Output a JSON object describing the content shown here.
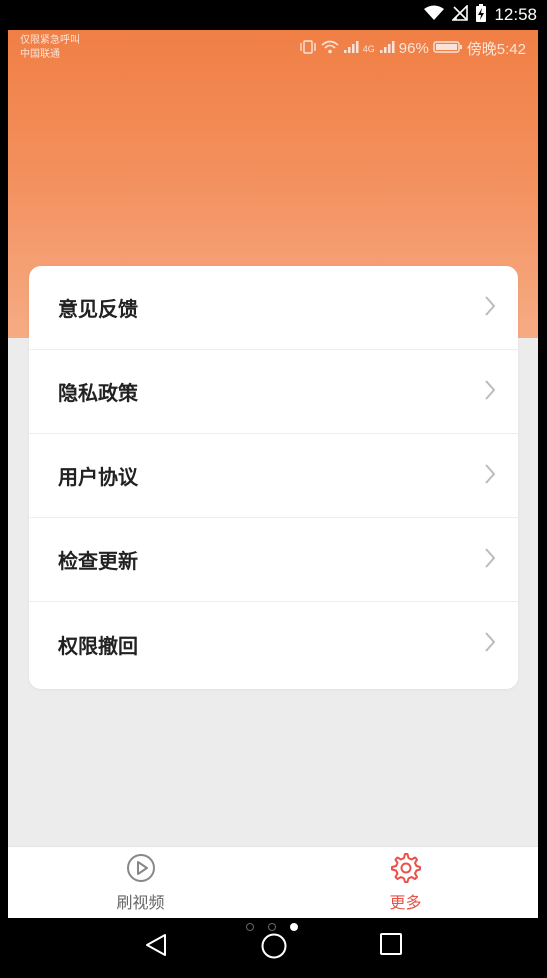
{
  "system_bar": {
    "time": "12:58"
  },
  "inner_status": {
    "carrier_line1": "仅限紧急呼叫",
    "carrier_line2": "中国联通",
    "signal_type": "4G",
    "battery": "96%",
    "time": "傍晚5:42"
  },
  "menu": {
    "items": [
      {
        "label": "意见反馈"
      },
      {
        "label": "隐私政策"
      },
      {
        "label": "用户协议"
      },
      {
        "label": "检查更新"
      },
      {
        "label": "权限撤回"
      }
    ]
  },
  "tabs": [
    {
      "label": "刷视频",
      "icon": "play-circle-icon",
      "active": false
    },
    {
      "label": "更多",
      "icon": "gear-icon",
      "active": true
    }
  ],
  "colors": {
    "accent": "#e9524a",
    "hero_top": "#f07f45",
    "hero_bottom": "#f6ab84",
    "inactive_tab": "#888888",
    "chevron": "#bbbbbb"
  }
}
